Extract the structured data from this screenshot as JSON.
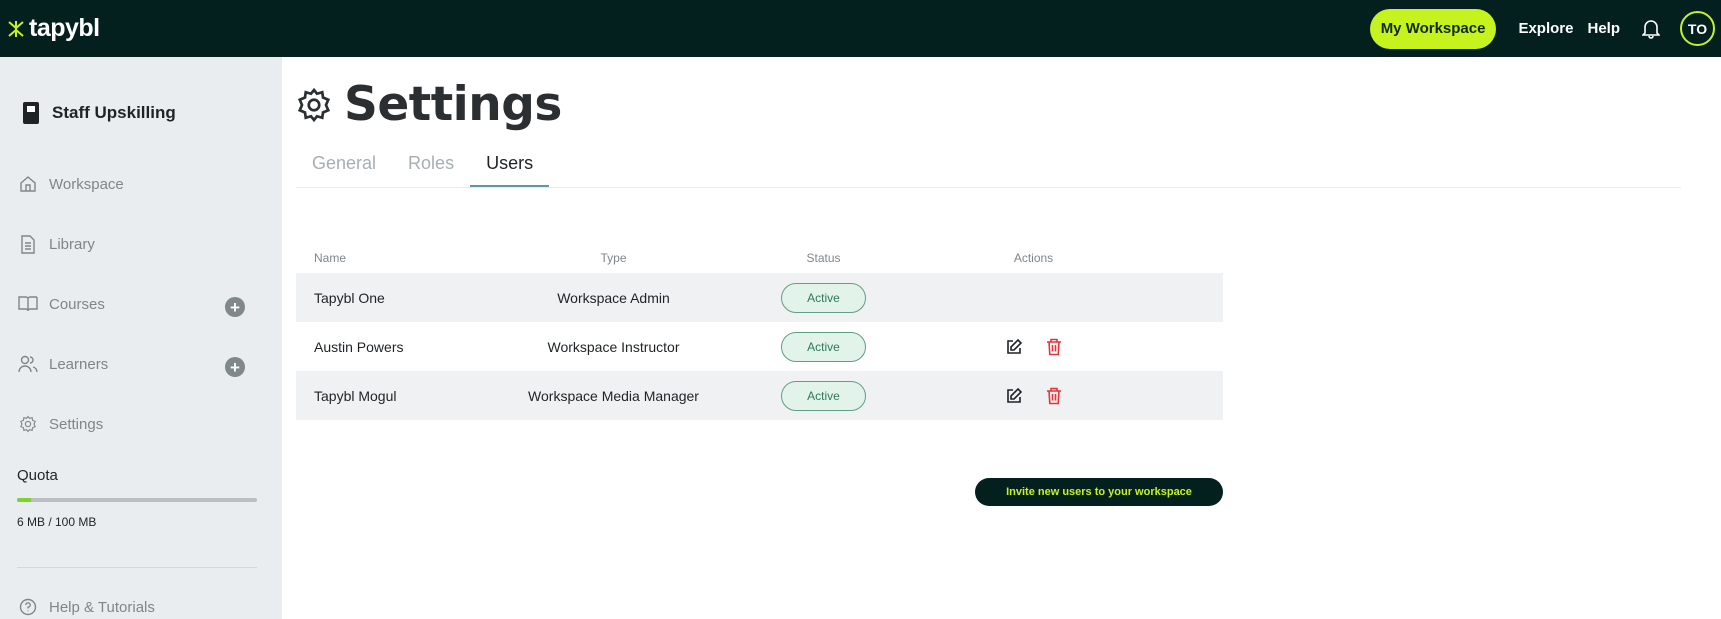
{
  "brand": {
    "name": "tapybl",
    "accent": "#c6f31e",
    "dark": "#03201f"
  },
  "topbar": {
    "workspace_button": "My Workspace",
    "explore": "Explore",
    "help": "Help",
    "avatar_initials": "TO"
  },
  "sidebar": {
    "workspace_name": "Staff Upskilling",
    "items": [
      {
        "label": "Workspace",
        "icon": "home-icon"
      },
      {
        "label": "Library",
        "icon": "document-icon"
      },
      {
        "label": "Courses",
        "icon": "book-open-icon"
      },
      {
        "label": "Learners",
        "icon": "users-icon"
      },
      {
        "label": "Settings",
        "icon": "gear-icon"
      }
    ],
    "quota": {
      "label": "Quota",
      "text": "6 MB / 100 MB",
      "used_fraction": 0.06
    },
    "help": "Help & Tutorials"
  },
  "main": {
    "title": "Settings",
    "tabs": [
      "General",
      "Roles",
      "Users"
    ],
    "active_tab": "Users",
    "table": {
      "headers": [
        "Name",
        "Type",
        "Status",
        "Actions"
      ],
      "rows": [
        {
          "name": "Tapybl One",
          "type": "Workspace Admin",
          "status": "Active",
          "actions": false
        },
        {
          "name": "Austin Powers",
          "type": "Workspace Instructor",
          "status": "Active",
          "actions": true
        },
        {
          "name": "Tapybl Mogul",
          "type": "Workspace Media Manager",
          "status": "Active",
          "actions": true
        }
      ]
    },
    "invite_button": "Invite new users to your workspace"
  }
}
